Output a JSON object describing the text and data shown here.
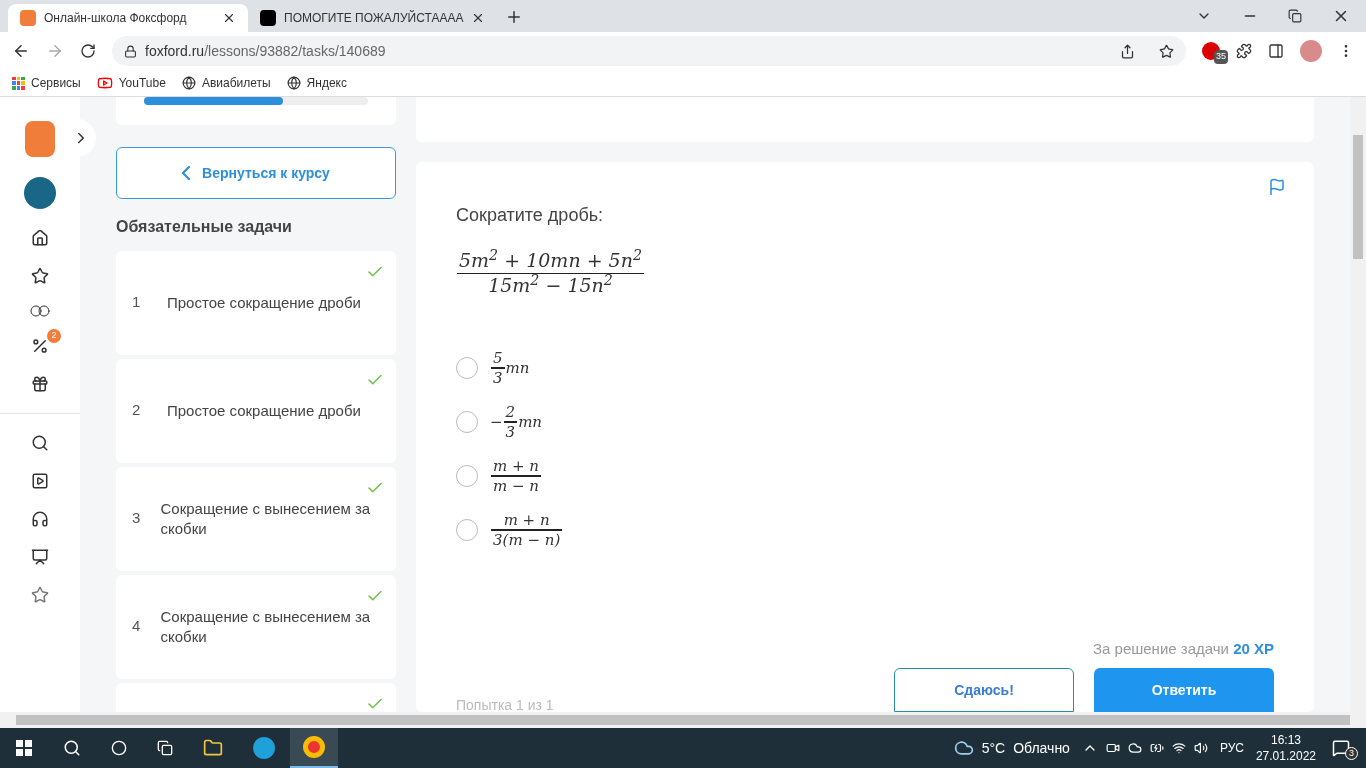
{
  "browser": {
    "tabs": [
      {
        "title": "Онлайн-школа Фоксфорд",
        "selected": true
      },
      {
        "title": "ПОМОГИТЕ ПОЖАЛУЙСТАААА",
        "selected": false
      }
    ],
    "url_host": "foxford.ru",
    "url_path": "/lessons/93882/tasks/140689",
    "bookmarks": [
      "Сервисы",
      "YouTube",
      "Авиабилеты",
      "Яндекс"
    ],
    "extension_badge": "35"
  },
  "nav": {
    "discount_badge": "2"
  },
  "lesson": {
    "progress": {
      "level": 0.62
    },
    "back_button": "Вернуться к курсу",
    "section_title": "Обязательные задачи",
    "tasks": [
      {
        "number": "1",
        "title": "Простое сокращение дроби",
        "done": true
      },
      {
        "number": "2",
        "title": "Простое сокращение дроби",
        "done": true
      },
      {
        "number": "3",
        "title": "Сокращение с вынесением за скобки",
        "done": true
      },
      {
        "number": "4",
        "title": "Сокращение с вынесением за скобки",
        "done": true
      },
      {
        "done": true
      }
    ]
  },
  "task": {
    "prompt": "Сократите дробь:",
    "expression": {
      "numerator": "5m$^{2}$ + 10mn + 5n$^{2}$",
      "denominator": "15m$^{2}$ − 15n$^{2}$"
    },
    "options": [
      {
        "numerator": "5",
        "denominator": "3",
        "suffix": "mn",
        "selected": false
      },
      {
        "prefix": "−",
        "numerator": "2",
        "denominator": "3",
        "suffix": "mn",
        "selected": false
      },
      {
        "numerator": "m + n",
        "denominator": "m − n",
        "selected": false
      },
      {
        "numerator": "m + n",
        "denominator": "3(m − n)",
        "selected": false
      }
    ],
    "reward_label": "За решение задачи",
    "reward_value": "20 XP",
    "give_up_button": "Сдаюсь!",
    "answer_button": "Ответить",
    "attempts": "Попытка 1 из 1"
  },
  "taskbar": {
    "weather_temp": "5°C",
    "weather_text": "Облачно",
    "language": "РУС",
    "time": "16:13",
    "date": "27.01.2022",
    "notifications": "3"
  }
}
